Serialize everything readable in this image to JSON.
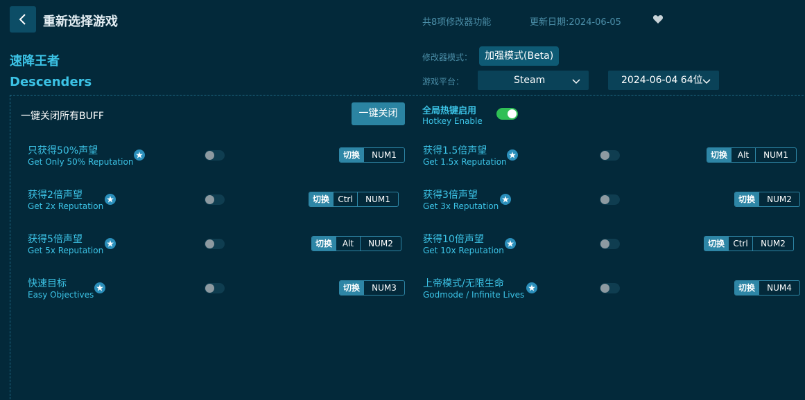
{
  "header": {
    "reselect_label": "重新选择游戏",
    "feature_count": "共8项修改器功能",
    "update_date": "更新日期:2024-06-05"
  },
  "game": {
    "title_cn": "速降王者",
    "title_en": "Descenders"
  },
  "settings": {
    "mode_label": "修改器模式：",
    "mode_value": "加强模式(Beta)",
    "platform_label": "游戏平台：",
    "platform_value": "Steam",
    "version_value": "2024-06-04 64位"
  },
  "controls": {
    "all_off_label": "一键关闭所有BUFF",
    "all_off_button": "一键关闭",
    "hotkey_cn": "全局热键启用",
    "hotkey_en": "Hotkey Enable",
    "hotkey_enabled": true
  },
  "hotkey_switch_label": "切换",
  "features": [
    {
      "cn": "只获得50%声望",
      "en": "Get Only 50% Reputation",
      "enabled": false,
      "mod": "",
      "key": "NUM1"
    },
    {
      "cn": "获得1.5倍声望",
      "en": "Get 1.5x Reputation",
      "enabled": false,
      "mod": "Alt",
      "key": "NUM1"
    },
    {
      "cn": "获得2倍声望",
      "en": "Get 2x Reputation",
      "enabled": false,
      "mod": "Ctrl",
      "key": "NUM1"
    },
    {
      "cn": "获得3倍声望",
      "en": "Get 3x Reputation",
      "enabled": false,
      "mod": "",
      "key": "NUM2"
    },
    {
      "cn": "获得5倍声望",
      "en": "Get 5x Reputation",
      "enabled": false,
      "mod": "Alt",
      "key": "NUM2"
    },
    {
      "cn": "获得10倍声望",
      "en": "Get 10x Reputation",
      "enabled": false,
      "mod": "Ctrl",
      "key": "NUM2"
    },
    {
      "cn": "快速目标",
      "en": "Easy Objectives",
      "enabled": false,
      "mod": "",
      "key": "NUM3"
    },
    {
      "cn": "上帝模式/无限生命",
      "en": "Godmode / Infinite Lives",
      "enabled": false,
      "mod": "",
      "key": "NUM4"
    }
  ],
  "colors": {
    "background": "#03293a",
    "accent": "#3cc3e6",
    "toggle_on": "#2fbf55",
    "button": "#2b84a2"
  },
  "icons": {
    "back": "chevron-left-icon",
    "favorite": "heart-icon",
    "dropdown": "chevron-down-icon",
    "feature_badge": "star-icon"
  }
}
